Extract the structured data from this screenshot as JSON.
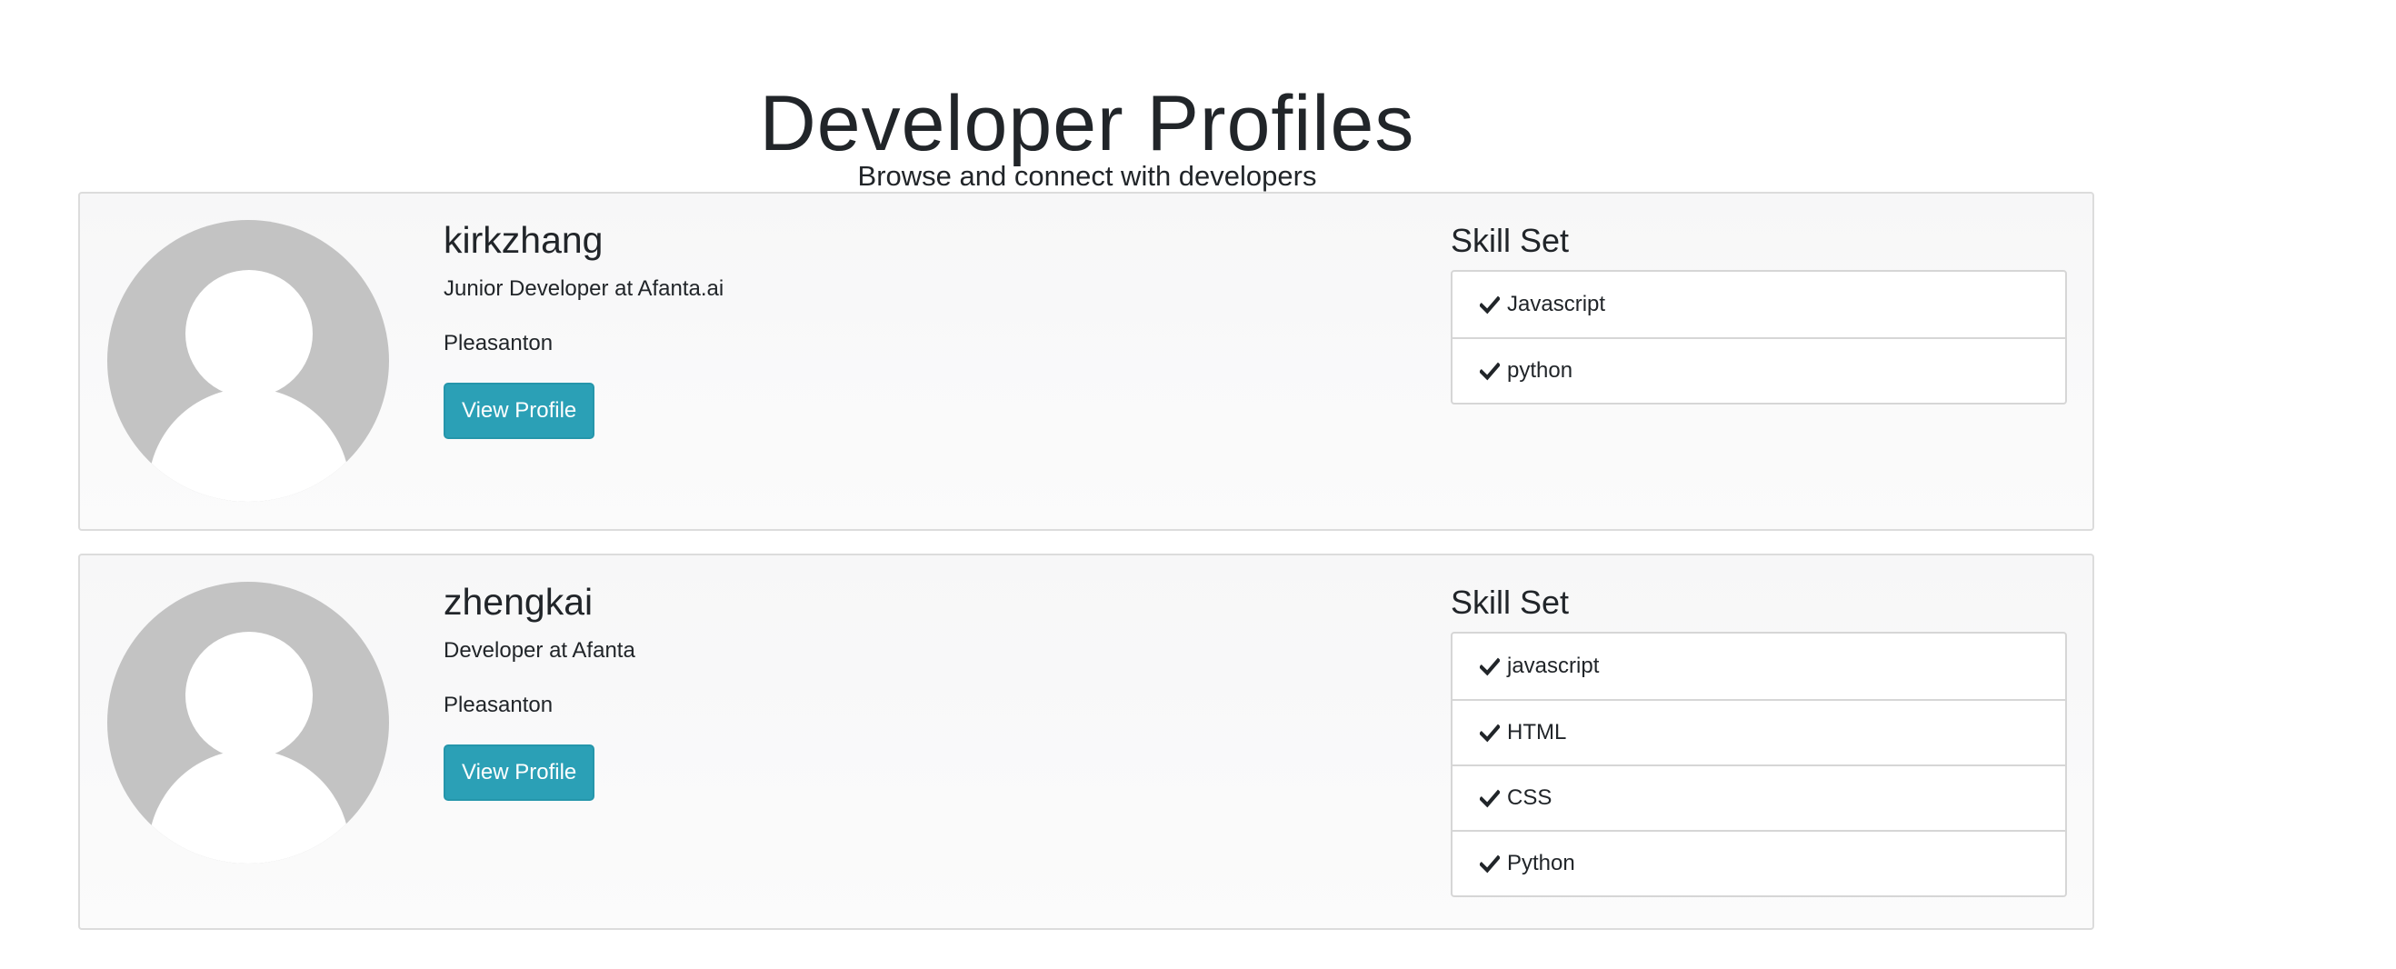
{
  "header": {
    "title": "Developer Profiles",
    "subtitle": "Browse and connect with developers"
  },
  "profiles": [
    {
      "username": "kirkzhang",
      "job_title": "Junior Developer at Afanta.ai",
      "location": "Pleasanton",
      "button_label": "View Profile",
      "skills_heading": "Skill Set",
      "skills": [
        "Javascript",
        "python"
      ]
    },
    {
      "username": "zhengkai",
      "job_title": "Developer at Afanta",
      "location": "Pleasanton",
      "button_label": "View Profile",
      "skills_heading": "Skill Set",
      "skills": [
        "javascript",
        "HTML",
        "CSS",
        "Python"
      ]
    }
  ],
  "colors": {
    "button": "#2ba0b6",
    "avatar": "#c3c3c3",
    "card_background": "#f7f7f8"
  },
  "icons": {
    "avatar": "default-avatar-icon",
    "skill": "check-icon"
  }
}
